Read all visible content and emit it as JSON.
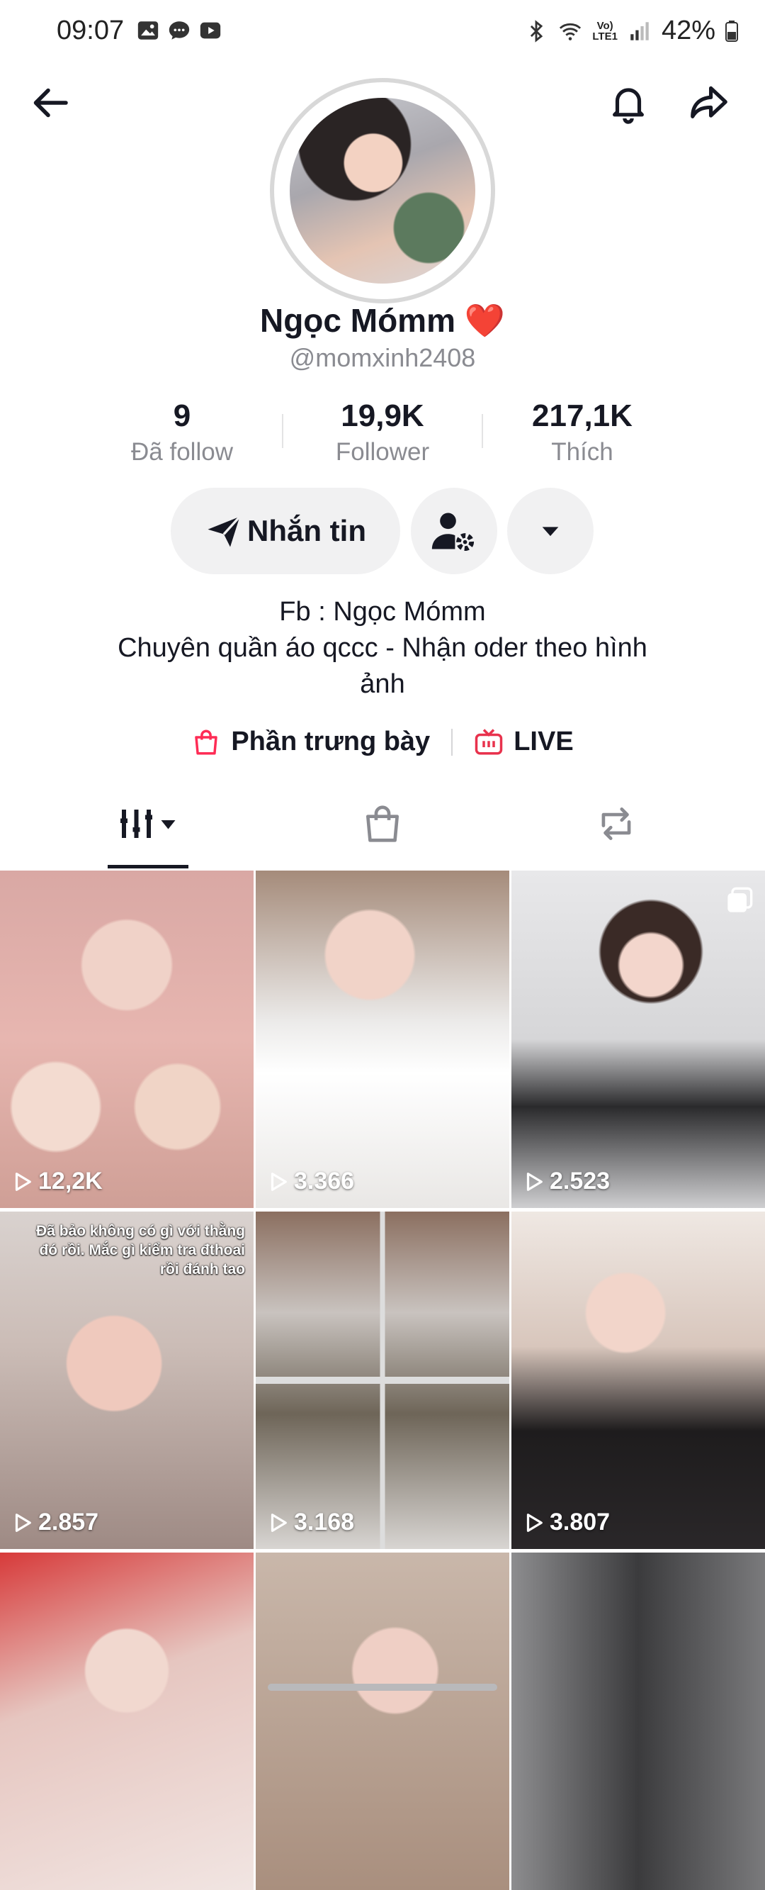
{
  "status_bar": {
    "time": "09:07",
    "network": "LTE1",
    "battery": "42%"
  },
  "profile": {
    "name": "Ngọc Mómm",
    "name_emoji": "❤️",
    "handle": "@momxinh2408"
  },
  "stats": [
    {
      "value": "9",
      "label": "Đã follow"
    },
    {
      "value": "19,9K",
      "label": "Follower"
    },
    {
      "value": "217,1K",
      "label": "Thích"
    }
  ],
  "actions": {
    "message_label": "Nhắn tin"
  },
  "bio": {
    "line1": "Fb : Ngọc Mómm",
    "line2": "Chuyên quần áo qccc - Nhận oder theo hình",
    "line3": "ảnh"
  },
  "links": {
    "showcase": "Phần trưng bày",
    "live": "LIVE"
  },
  "tabs": {
    "active": "videos"
  },
  "videos": [
    {
      "views": "12,2K",
      "caption": ""
    },
    {
      "views": "3.366",
      "caption": ""
    },
    {
      "views": "2.523",
      "caption": ""
    },
    {
      "views": "2.857",
      "caption": "Đã bảo không có gì với thằng đó rồi. Mắc gì kiểm tra đthoai rồi đánh tao"
    },
    {
      "views": "3.168",
      "caption": ""
    },
    {
      "views": "3.807",
      "caption": ""
    },
    {
      "views": "",
      "caption": ""
    },
    {
      "views": "",
      "caption": ""
    },
    {
      "views": "",
      "caption": ""
    }
  ],
  "colors": {
    "accent_pink": "#fe2c55",
    "live_red": "#e8324d",
    "text": "#161823",
    "muted": "#8a8b91"
  }
}
